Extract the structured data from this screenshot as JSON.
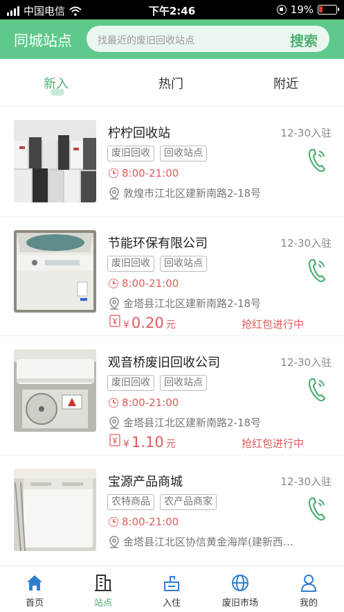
{
  "status_bar": {
    "carrier": "中国电信",
    "time": "下午2:46",
    "battery": "19%"
  },
  "header": {
    "title": "同城站点",
    "search_placeholder": "找最近的废旧回收站点",
    "search_button": "搜索"
  },
  "tabs": [
    {
      "label": "新入",
      "active": true
    },
    {
      "label": "热门"
    },
    {
      "label": "附近"
    }
  ],
  "stations": [
    {
      "name": "柠柠回收站",
      "date": "12-30入驻",
      "tags": [
        "废旧回收",
        "回收站点"
      ],
      "hours": "8:00-21:00",
      "address": "敦煌市江北区建新南路2-18号",
      "image": "fridges"
    },
    {
      "name": "节能环保有限公司",
      "date": "12-30入驻",
      "tags": [
        "废旧回收",
        "回收站点"
      ],
      "hours": "8:00-21:00",
      "address": "金塔县江北区建新南路2-18号",
      "price": {
        "currency": "¥",
        "value": "0.20",
        "unit": "元"
      },
      "promo": "抢红包进行中",
      "image": "washer"
    },
    {
      "name": "观音桥废旧回收公司",
      "date": "12-30入驻",
      "tags": [
        "废旧回收",
        "回收站点"
      ],
      "hours": "8:00-21:00",
      "address": "金塔县江北区建新南路2-18号",
      "price": {
        "currency": "¥",
        "value": "1.10",
        "unit": "元"
      },
      "promo": "抢红包进行中",
      "image": "aircon"
    },
    {
      "name": "宝源产品商城",
      "date": "12-30入驻",
      "tags": [
        "农特商品",
        "农产品商家"
      ],
      "hours": "8:00-21:00",
      "address": "金塔县江北区协信黄金海岸(建新西…",
      "image": "twin-washer"
    }
  ],
  "bottom_nav": [
    {
      "label": "首页",
      "icon": "home-icon"
    },
    {
      "label": "站点",
      "icon": "building-icon",
      "active": true
    },
    {
      "label": "入住",
      "icon": "enter-icon"
    },
    {
      "label": "废旧市场",
      "icon": "globe-icon"
    },
    {
      "label": "我的",
      "icon": "user-icon"
    }
  ],
  "colors": {
    "brand": "#5fc98b",
    "accent": "#4caf72",
    "price": "#e05a5a"
  }
}
